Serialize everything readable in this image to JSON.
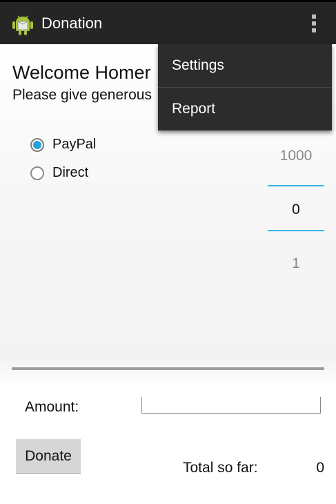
{
  "action_bar": {
    "title": "Donation",
    "app_icon": "android-icon",
    "overflow_icon": "overflow-menu-icon"
  },
  "welcome": {
    "heading": "Welcome Homer",
    "subheading": "Please give generous"
  },
  "payment_methods": [
    {
      "label": "PayPal",
      "checked": true
    },
    {
      "label": "Direct",
      "checked": false
    }
  ],
  "amount_picker": {
    "previous": "1000",
    "current": "0",
    "next": "1"
  },
  "amount": {
    "label": "Amount:",
    "value": ""
  },
  "donate_button": "Donate",
  "total": {
    "label": "Total so far:",
    "value": "0"
  },
  "overflow_menu": [
    {
      "label": "Settings"
    },
    {
      "label": "Report"
    }
  ],
  "colors": {
    "action_bar": "#252525",
    "accent": "#33b5e5",
    "radio_fill": "#27a2d5",
    "menu_bg": "#2c2c2c"
  }
}
